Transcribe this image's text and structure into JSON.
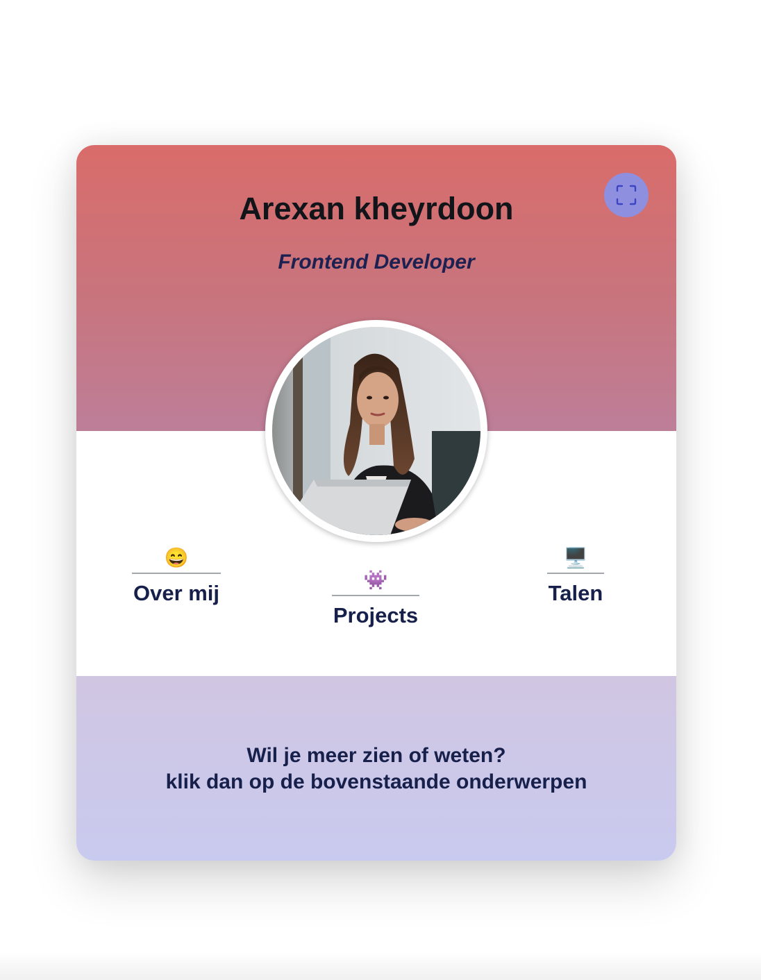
{
  "profile": {
    "name": "Arexan kheyrdoon",
    "role": "Frontend Developer"
  },
  "controls": {
    "fullscreen_icon": "fullscreen-icon"
  },
  "nav": {
    "items": [
      {
        "id": "over-mij",
        "label": "Over mij",
        "icon": "😄",
        "icon_name": "grinning-face-icon"
      },
      {
        "id": "projects",
        "label": "Projects",
        "icon": "👾",
        "icon_name": "alien-monster-icon"
      },
      {
        "id": "talen",
        "label": "Talen",
        "icon": "🖥️",
        "icon_name": "desktop-computer-icon"
      }
    ]
  },
  "footer": {
    "line1": "Wil je meer zien of weten?",
    "line2": "klik dan op de bovenstaande onderwerpen"
  },
  "colors": {
    "header_top": "#d96c6a",
    "header_bottom": "#bd7e98",
    "footer_top": "#d0c6e2",
    "footer_bottom": "#c9caef",
    "fullscreen_button": "#8f8fe0",
    "text_dark": "#16204a"
  }
}
